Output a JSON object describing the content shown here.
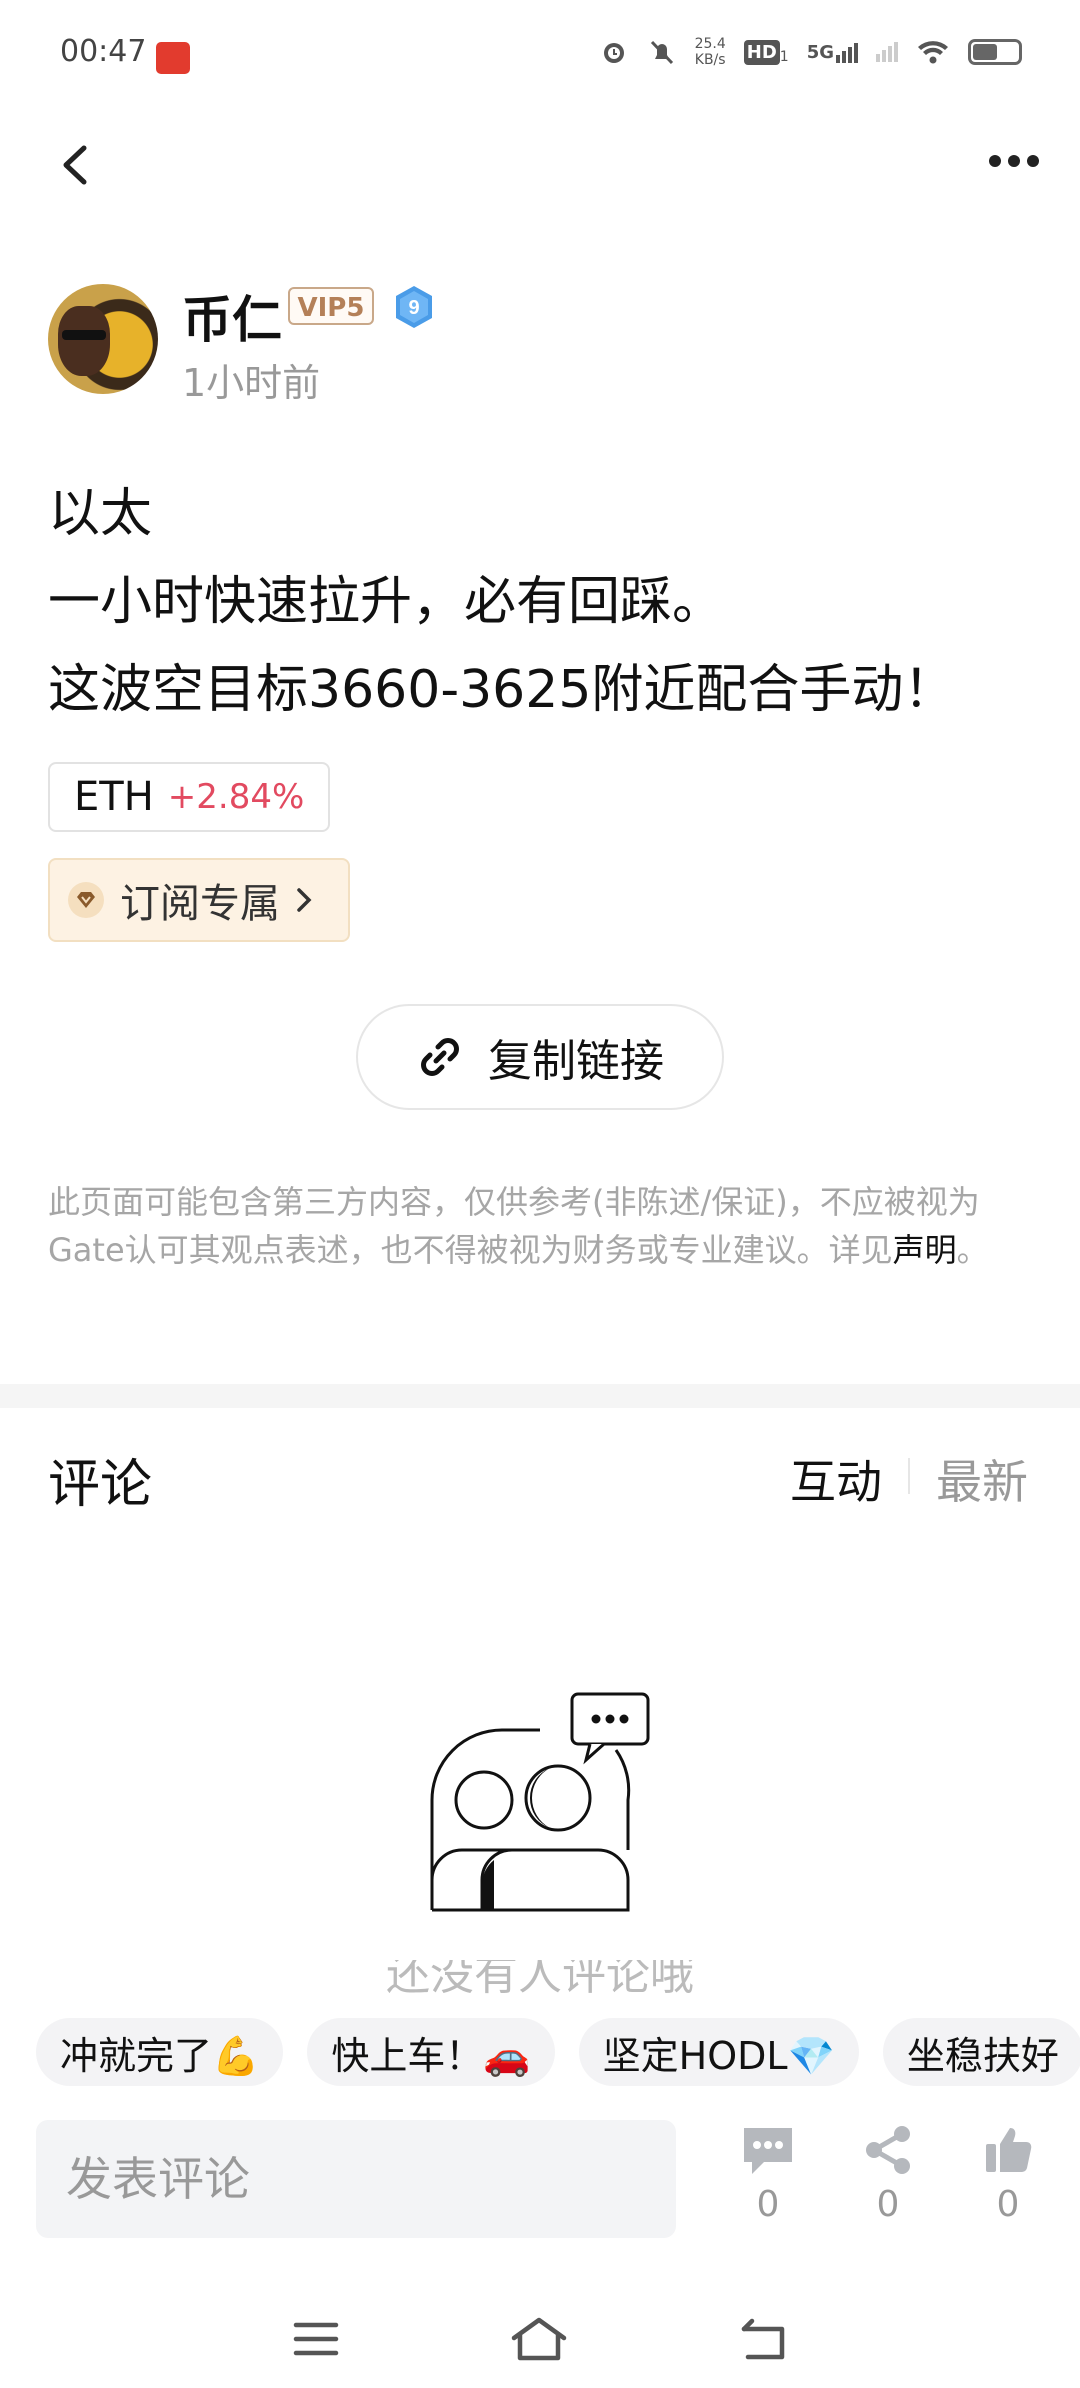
{
  "status_bar": {
    "time": "00:47",
    "net_speed_value": "25.4",
    "net_speed_unit": "KB/s",
    "hd_label": "HD",
    "hd_sub": "1",
    "signal_label": "5G"
  },
  "author": {
    "name": "币仁",
    "vip_badge": "VIP5",
    "level_badge": "9",
    "time_ago": "1小时前"
  },
  "post": {
    "lines": [
      "以太",
      "一小时快速拉升，必有回踩。",
      "这波空目标3660-3625附近配合手动！"
    ]
  },
  "coin_tag": {
    "symbol": "ETH",
    "change": "+2.84%",
    "change_color": "#e24a60"
  },
  "subscribe_tag": {
    "label": "订阅专属"
  },
  "copy_link": {
    "label": "复制链接"
  },
  "disclaimer": {
    "text": "此页面可能包含第三方内容，仅供参考(非陈述/保证)，不应被视为Gate认可其观点表述，也不得被视为财务或专业建议。详见",
    "link": "声明",
    "end": "。"
  },
  "comments": {
    "title": "评论",
    "sort_active": "互动",
    "sort_latest": "最新",
    "empty_text": "还没有人评论哦"
  },
  "quick_replies": [
    {
      "label": "冲就完了💪"
    },
    {
      "label": "快上车！🚗"
    },
    {
      "label": "坚定HODL💎"
    },
    {
      "label": "坐稳扶好"
    }
  ],
  "bottom_bar": {
    "input_placeholder": "发表评论",
    "comment_count": "0",
    "share_count": "0",
    "like_count": "0"
  },
  "icons": {
    "back": "chevron-left-icon",
    "more": "more-dots-icon",
    "link": "link-icon",
    "gem": "diamond-icon",
    "comment": "comment-bubble-icon",
    "share": "share-icon",
    "like": "thumbs-up-icon"
  }
}
